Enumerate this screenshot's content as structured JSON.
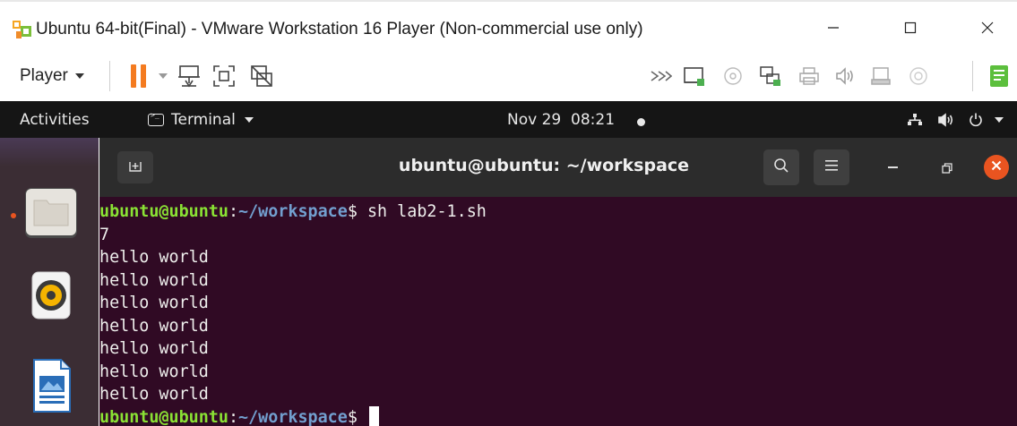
{
  "window": {
    "title": "Ubuntu 64-bit(Final) - VMware Workstation 16 Player (Non-commercial use only)",
    "controls": {
      "minimize_icon": "minimize-icon",
      "maximize_icon": "maximize-icon",
      "close_icon": "close-icon"
    }
  },
  "toolbar": {
    "player_label": "Player",
    "icons": [
      "pause-icon",
      "dropdown-icon",
      "send-ctrl-alt-del-icon",
      "fullscreen-icon",
      "unity-icon",
      "forward-icon",
      "removable-device-icon",
      "cd-icon",
      "network-icon",
      "printer-icon",
      "sound-icon",
      "usb-icon",
      "disk-icon",
      "message-icon"
    ]
  },
  "ubuntu_panel": {
    "activities_label": "Activities",
    "app_menu_label": "Terminal",
    "clock": "Nov 29  08:21",
    "system_icons": [
      "network-wired-icon",
      "volume-icon",
      "power-icon",
      "chevron-down-icon"
    ]
  },
  "dock": {
    "items": [
      {
        "name": "files",
        "icon": "files-folder-icon",
        "active": true
      },
      {
        "name": "rhythmbox",
        "icon": "rhythmbox-speaker-icon",
        "active": false
      },
      {
        "name": "libreoffice-writer",
        "icon": "writer-document-icon",
        "active": false
      }
    ]
  },
  "terminal": {
    "title": "ubuntu@ubuntu: ~/workspace",
    "prompt": {
      "user_host": "ubuntu@ubuntu",
      "colon": ":",
      "path": "~/workspace",
      "symbol": "$ "
    },
    "command": "sh lab2-1.sh",
    "output": [
      "7",
      "hello world",
      "hello world",
      "hello world",
      "hello world",
      "hello world",
      "hello world",
      "hello world"
    ],
    "colors": {
      "background": "#300a24",
      "prompt_user": "#8ae234",
      "prompt_path": "#729fcf",
      "close_button": "#e95420"
    }
  }
}
